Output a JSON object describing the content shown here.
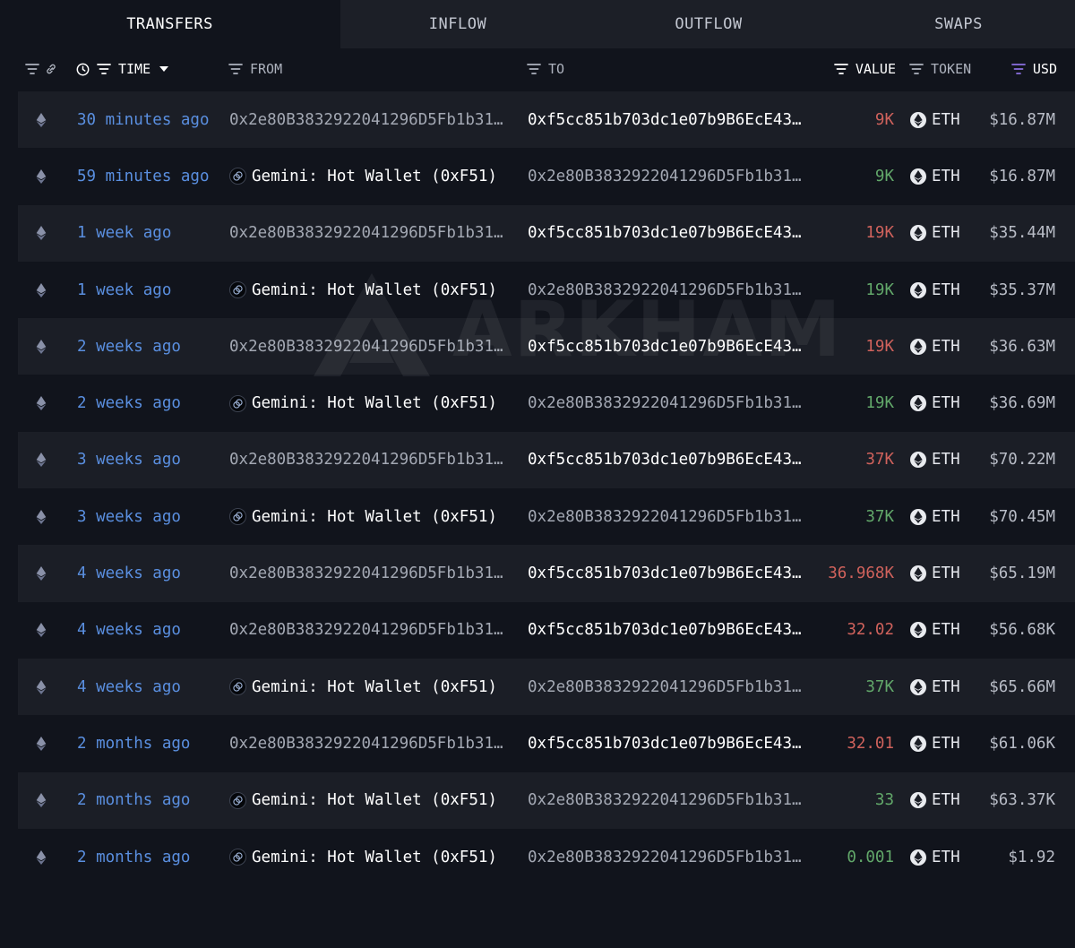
{
  "tabs": [
    "TRANSFERS",
    "INFLOW",
    "OUTFLOW",
    "SWAPS"
  ],
  "active_tab": "TRANSFERS",
  "columns": {
    "time": "TIME",
    "from": "FROM",
    "to": "TO",
    "value": "VALUE",
    "token": "TOKEN",
    "usd": "USD"
  },
  "watermark": "ARKHAM",
  "colors": {
    "accent": "#5a8fe0",
    "outflow": "#d0625c",
    "inflow": "#62a86a",
    "usd_filter": "#8b6fe0"
  },
  "icons": {
    "chain": "ethereum-icon",
    "token": "eth-token-icon",
    "entity": "gemini-entity-icon",
    "filter": "filter-icon",
    "link": "link-icon",
    "clock": "clock-icon",
    "sort": "sort-down-icon"
  },
  "rows": [
    {
      "time": "30 minutes ago",
      "from": "0x2e80B3832922041296D5Fb1b31…",
      "from_entity": false,
      "to": "0xf5cc851b703dc1e07b9B6EcE43…",
      "to_entity": false,
      "value": "9K",
      "direction": "out",
      "token": "ETH",
      "usd": "$16.87M"
    },
    {
      "time": "59 minutes ago",
      "from": "Gemini: Hot Wallet (0xF51)",
      "from_entity": true,
      "to": "0x2e80B3832922041296D5Fb1b31…",
      "to_entity": false,
      "value": "9K",
      "direction": "in",
      "token": "ETH",
      "usd": "$16.87M"
    },
    {
      "time": "1 week ago",
      "from": "0x2e80B3832922041296D5Fb1b31…",
      "from_entity": false,
      "to": "0xf5cc851b703dc1e07b9B6EcE43…",
      "to_entity": false,
      "value": "19K",
      "direction": "out",
      "token": "ETH",
      "usd": "$35.44M"
    },
    {
      "time": "1 week ago",
      "from": "Gemini: Hot Wallet (0xF51)",
      "from_entity": true,
      "to": "0x2e80B3832922041296D5Fb1b31…",
      "to_entity": false,
      "value": "19K",
      "direction": "in",
      "token": "ETH",
      "usd": "$35.37M"
    },
    {
      "time": "2 weeks ago",
      "from": "0x2e80B3832922041296D5Fb1b31…",
      "from_entity": false,
      "to": "0xf5cc851b703dc1e07b9B6EcE43…",
      "to_entity": false,
      "value": "19K",
      "direction": "out",
      "token": "ETH",
      "usd": "$36.63M"
    },
    {
      "time": "2 weeks ago",
      "from": "Gemini: Hot Wallet (0xF51)",
      "from_entity": true,
      "to": "0x2e80B3832922041296D5Fb1b31…",
      "to_entity": false,
      "value": "19K",
      "direction": "in",
      "token": "ETH",
      "usd": "$36.69M"
    },
    {
      "time": "3 weeks ago",
      "from": "0x2e80B3832922041296D5Fb1b31…",
      "from_entity": false,
      "to": "0xf5cc851b703dc1e07b9B6EcE43…",
      "to_entity": false,
      "value": "37K",
      "direction": "out",
      "token": "ETH",
      "usd": "$70.22M"
    },
    {
      "time": "3 weeks ago",
      "from": "Gemini: Hot Wallet (0xF51)",
      "from_entity": true,
      "to": "0x2e80B3832922041296D5Fb1b31…",
      "to_entity": false,
      "value": "37K",
      "direction": "in",
      "token": "ETH",
      "usd": "$70.45M"
    },
    {
      "time": "4 weeks ago",
      "from": "0x2e80B3832922041296D5Fb1b31…",
      "from_entity": false,
      "to": "0xf5cc851b703dc1e07b9B6EcE43…",
      "to_entity": false,
      "value": "36.968K",
      "direction": "out",
      "token": "ETH",
      "usd": "$65.19M"
    },
    {
      "time": "4 weeks ago",
      "from": "0x2e80B3832922041296D5Fb1b31…",
      "from_entity": false,
      "to": "0xf5cc851b703dc1e07b9B6EcE43…",
      "to_entity": false,
      "value": "32.02",
      "direction": "out",
      "token": "ETH",
      "usd": "$56.68K"
    },
    {
      "time": "4 weeks ago",
      "from": "Gemini: Hot Wallet (0xF51)",
      "from_entity": true,
      "to": "0x2e80B3832922041296D5Fb1b31…",
      "to_entity": false,
      "value": "37K",
      "direction": "in",
      "token": "ETH",
      "usd": "$65.66M"
    },
    {
      "time": "2 months ago",
      "from": "0x2e80B3832922041296D5Fb1b31…",
      "from_entity": false,
      "to": "0xf5cc851b703dc1e07b9B6EcE43…",
      "to_entity": false,
      "value": "32.01",
      "direction": "out",
      "token": "ETH",
      "usd": "$61.06K"
    },
    {
      "time": "2 months ago",
      "from": "Gemini: Hot Wallet (0xF51)",
      "from_entity": true,
      "to": "0x2e80B3832922041296D5Fb1b31…",
      "to_entity": false,
      "value": "33",
      "direction": "in",
      "token": "ETH",
      "usd": "$63.37K"
    },
    {
      "time": "2 months ago",
      "from": "Gemini: Hot Wallet (0xF51)",
      "from_entity": true,
      "to": "0x2e80B3832922041296D5Fb1b31…",
      "to_entity": false,
      "value": "0.001",
      "direction": "in",
      "token": "ETH",
      "usd": "$1.92"
    }
  ]
}
